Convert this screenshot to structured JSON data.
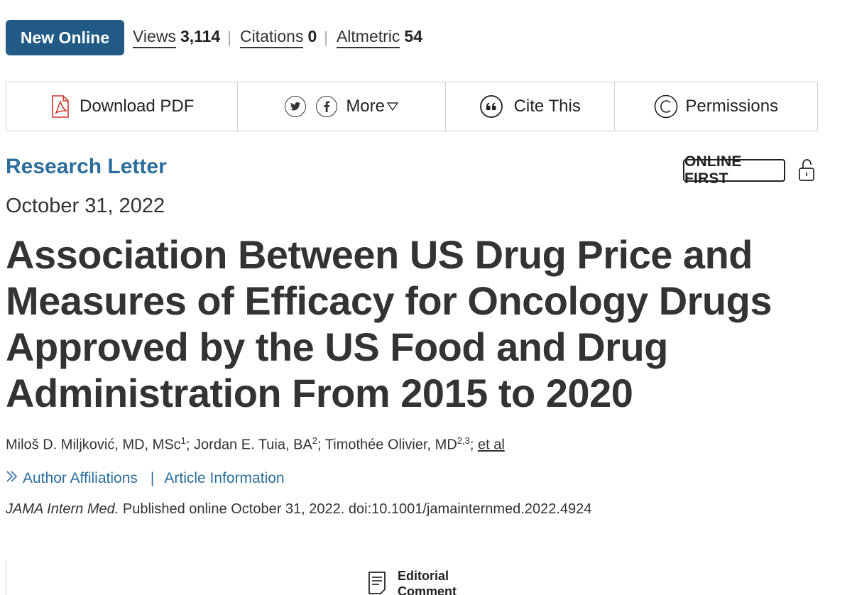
{
  "header": {
    "badge_label": "New Online",
    "metrics": [
      {
        "label": "Views",
        "value": "3,114"
      },
      {
        "label": "Citations",
        "value": "0"
      },
      {
        "label": "Altmetric",
        "value": "54"
      }
    ],
    "separator": "|"
  },
  "toolbar": {
    "download_label": "Download PDF",
    "more_label": "More",
    "cite_label": "Cite This",
    "permissions_label": "Permissions",
    "icons": [
      "pdf-icon",
      "twitter-icon",
      "facebook-icon",
      "caret-down-icon",
      "quote-icon",
      "copyright-icon"
    ]
  },
  "article": {
    "section": "Research Letter",
    "status_badge": "ONLINE FIRST",
    "date": "October 31, 2022",
    "title": "Association Between US Drug Price and Measures of Efficacy for Oncology Drugs Approved by the US Food and Drug Administration From 2015 to 2020",
    "authors": [
      {
        "name": "Miloš D. Miljković, MD, MSc",
        "sup": "1"
      },
      {
        "name": "Jordan E. Tuia, BA",
        "sup": "2"
      },
      {
        "name": "Timothée Olivier, MD",
        "sup": "2,3"
      }
    ],
    "author_sep": ";",
    "et_al": "et al",
    "links": {
      "affiliations": "Author Affiliations",
      "pipe": "|",
      "info": "Article Information"
    },
    "citation": {
      "journal": "JAMA Intern Med.",
      "rest": " Published online October 31, 2022. doi:10.1001/jamainternmed.2022.4924"
    }
  },
  "editorial": {
    "line1": "Editorial",
    "line2": "Comment"
  },
  "colors": {
    "badge_bg": "#225a86",
    "accent_blue": "#2c6e9c",
    "pdf_red": "#d0332b",
    "text": "#333333"
  }
}
